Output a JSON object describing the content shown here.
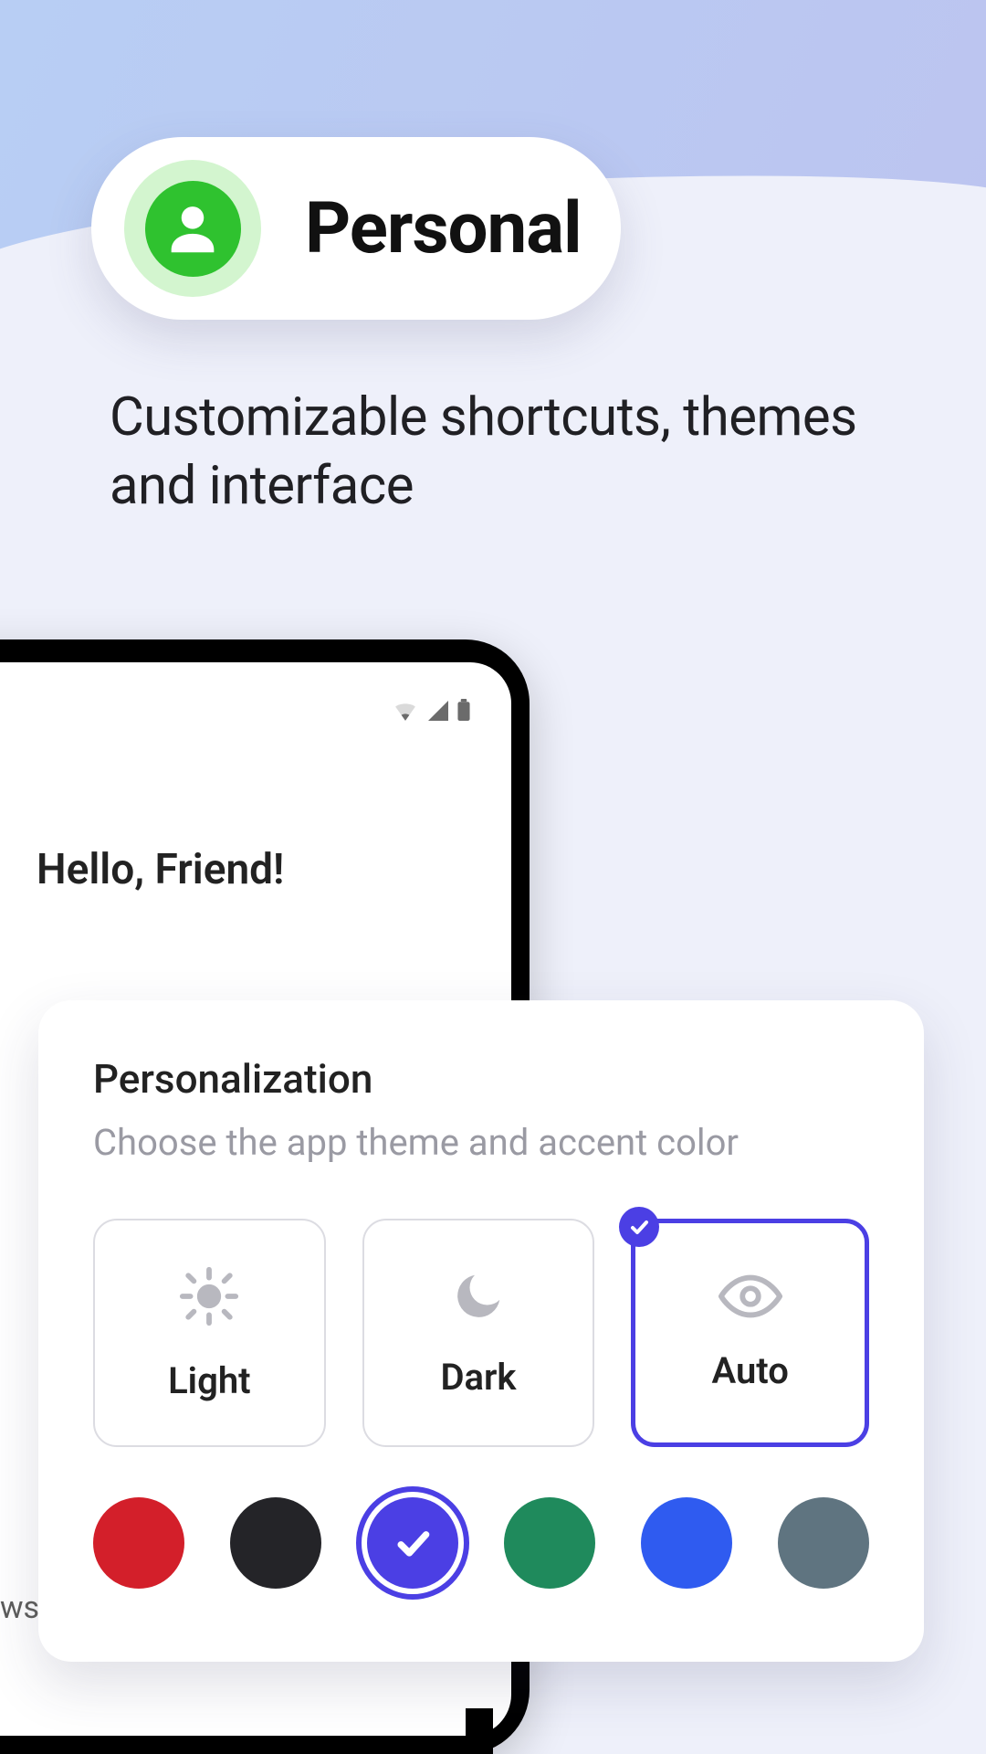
{
  "pill": {
    "label": "Personal"
  },
  "subheading": "Customizable shortcuts, themes and interface",
  "phone": {
    "greeting": "Hello, Friend!"
  },
  "card": {
    "title": "Personalization",
    "subtitle": "Choose the app theme and accent color",
    "themes": [
      {
        "id": "light",
        "label": "Light",
        "icon": "sun",
        "selected": false
      },
      {
        "id": "dark",
        "label": "Dark",
        "icon": "moon",
        "selected": false
      },
      {
        "id": "auto",
        "label": "Auto",
        "icon": "eye",
        "selected": true
      }
    ],
    "colors": [
      {
        "name": "red",
        "hex": "#d31f2a",
        "selected": false
      },
      {
        "name": "black",
        "hex": "#242428",
        "selected": false
      },
      {
        "name": "indigo",
        "hex": "#4b3fe4",
        "selected": true
      },
      {
        "name": "green",
        "hex": "#1f8a5c",
        "selected": false
      },
      {
        "name": "blue",
        "hex": "#2f5bf0",
        "selected": false
      },
      {
        "name": "slate",
        "hex": "#5f7480",
        "selected": false
      }
    ]
  },
  "edge_text": "ws"
}
